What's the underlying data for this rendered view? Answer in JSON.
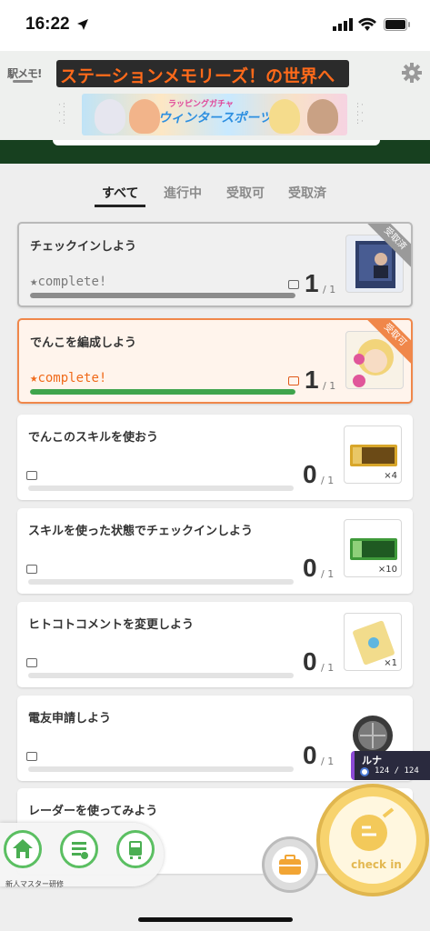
{
  "status": {
    "time": "16:22"
  },
  "header": {
    "logo": "駅メモ!",
    "ticker": "ステーションメモリーズ！の世界へ",
    "banner_title": "ラッピングガチャ",
    "banner_sub": "ウィンタースポーツ"
  },
  "tabs": [
    {
      "label": "すべて",
      "active": true
    },
    {
      "label": "進行中",
      "active": false
    },
    {
      "label": "受取可",
      "active": false
    },
    {
      "label": "受取済",
      "active": false
    }
  ],
  "missions": [
    {
      "title": "チェックインしよう",
      "status_text": "complete!",
      "count": "1",
      "total": "/ 1",
      "progress": 1.0,
      "ribbon": "受取済",
      "state": "done",
      "reward_qty": ""
    },
    {
      "title": "でんこを編成しよう",
      "status_text": "complete!",
      "count": "1",
      "total": "/ 1",
      "progress": 1.0,
      "ribbon": "受取可",
      "state": "claimable",
      "reward_qty": ""
    },
    {
      "title": "でんこのスキルを使おう",
      "status_text": "",
      "count": "0",
      "total": "/ 1",
      "progress": 0.0,
      "ribbon": "",
      "state": "plain",
      "reward_qty": "×4"
    },
    {
      "title": "スキルを使った状態でチェックインしよう",
      "status_text": "",
      "count": "0",
      "total": "/ 1",
      "progress": 0.0,
      "ribbon": "",
      "state": "plain",
      "reward_qty": "×10"
    },
    {
      "title": "ヒトコトコメントを変更しよう",
      "status_text": "",
      "count": "0",
      "total": "/ 1",
      "progress": 0.0,
      "ribbon": "",
      "state": "plain",
      "reward_qty": "×1"
    },
    {
      "title": "電友申請しよう",
      "status_text": "",
      "count": "0",
      "total": "/ 1",
      "progress": 0.0,
      "ribbon": "",
      "state": "plain",
      "reward_qty": ""
    },
    {
      "title": "レーダーを使ってみよう",
      "status_text": "",
      "count": "",
      "total": "",
      "progress": 0.0,
      "ribbon": "",
      "state": "plain",
      "reward_qty": ""
    }
  ],
  "partner": {
    "name": "ルナ",
    "hp": "124 / 124"
  },
  "bottom_nav": {
    "label": "新人マスター研修",
    "items": [
      "home-icon",
      "mission-list-icon",
      "train-icon"
    ]
  },
  "checkin": {
    "label": "check in"
  },
  "colors": {
    "accent_orange": "#f0874a",
    "green_band": "#17401f",
    "progress_green": "#3fa44c",
    "checkin_gold": "#f7d36e"
  }
}
